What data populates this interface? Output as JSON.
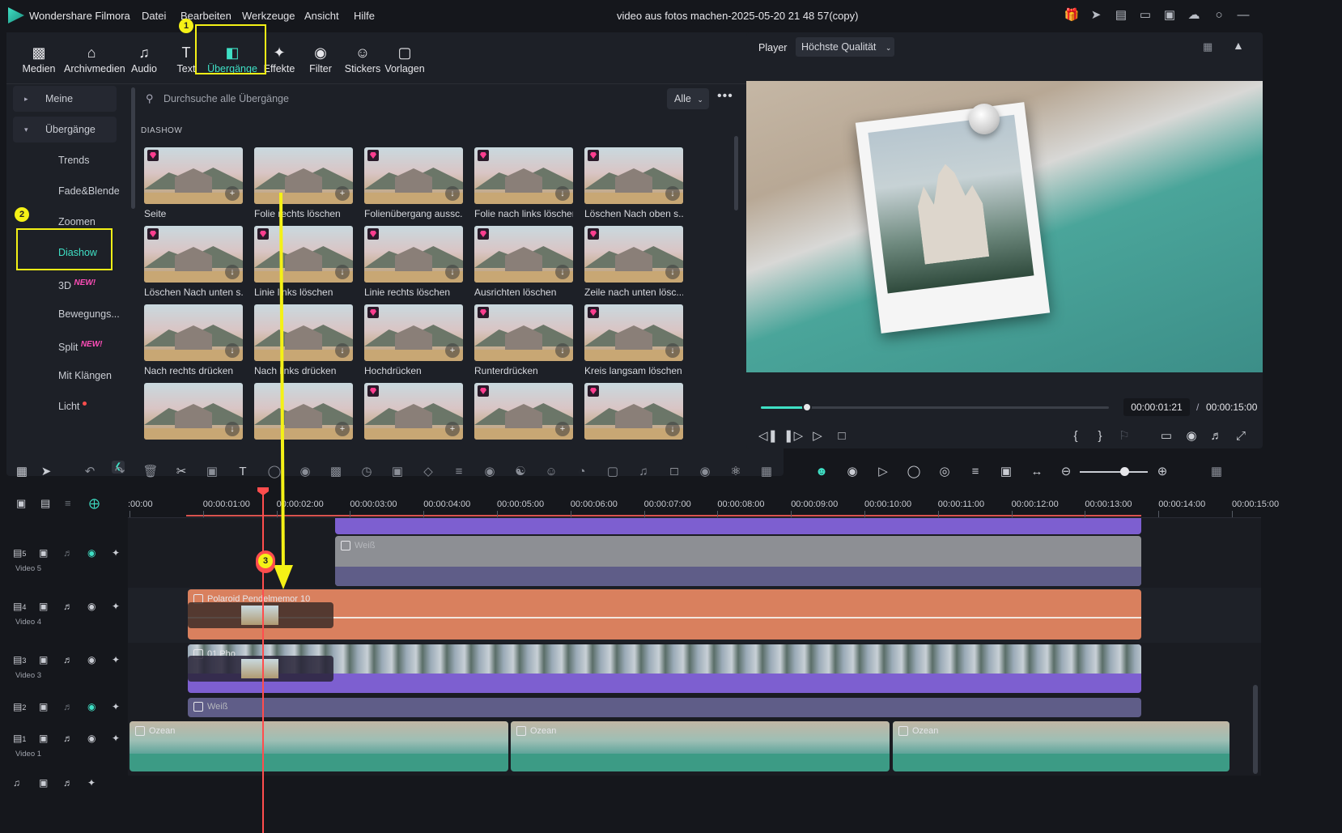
{
  "app": {
    "name": "Wondershare Filmora",
    "document_title": "video aus fotos machen-2025-05-20 21 48 57(copy)",
    "menu": [
      "Datei",
      "Bearbeiten",
      "Werkzeuge",
      "Ansicht",
      "Hilfe"
    ]
  },
  "colors": {
    "accent": "#3fe0c5",
    "highlight": "#f4f116",
    "playhead": "#ff4d4d",
    "clip_orange": "#d9805e",
    "clip_purple": "#7d5fd0",
    "clip_gray": "#8d8f94",
    "clip_teal": "#3c9b85"
  },
  "tabs": [
    {
      "label": "Medien",
      "icon": "media-icon"
    },
    {
      "label": "Archivmedien",
      "icon": "stock-media-icon"
    },
    {
      "label": "Audio",
      "icon": "music-note-icon"
    },
    {
      "label": "Text",
      "icon": "text-icon"
    },
    {
      "label": "Übergänge",
      "icon": "transition-icon",
      "active": true
    },
    {
      "label": "Effekte",
      "icon": "effects-icon"
    },
    {
      "label": "Filter",
      "icon": "filter-icon"
    },
    {
      "label": "Stickers",
      "icon": "sticker-icon"
    },
    {
      "label": "Vorlagen",
      "icon": "template-icon"
    }
  ],
  "sidebar": {
    "items": [
      {
        "label": "Meine",
        "type": "parent",
        "expanded": false
      },
      {
        "label": "Übergänge",
        "type": "parent",
        "expanded": true
      },
      {
        "label": "Trends",
        "type": "sub"
      },
      {
        "label": "Fade&Blende",
        "type": "sub"
      },
      {
        "label": "Zoomen",
        "type": "sub"
      },
      {
        "label": "Diashow",
        "type": "sub",
        "selected": true
      },
      {
        "label": "3D",
        "type": "sub",
        "tag": "NEW!"
      },
      {
        "label": "Bewegungs...",
        "type": "sub"
      },
      {
        "label": "Split",
        "type": "sub",
        "tag": "NEW!"
      },
      {
        "label": "Mit Klängen",
        "type": "sub"
      },
      {
        "label": "Licht",
        "type": "sub",
        "dot": true
      }
    ]
  },
  "search": {
    "placeholder": "Durchsuche alle Übergänge",
    "filter_value": "Alle"
  },
  "section_title": "DIASHOW",
  "transitions": [
    {
      "name": "Seite",
      "premium": true,
      "action": "add"
    },
    {
      "name": "Folie rechts löschen",
      "premium": false,
      "action": "add"
    },
    {
      "name": "Folienübergang aussc...",
      "premium": true,
      "action": "download"
    },
    {
      "name": "Folie nach links löschen",
      "premium": true,
      "action": "download"
    },
    {
      "name": "Löschen Nach oben s...",
      "premium": true,
      "action": "download"
    },
    {
      "name": "Löschen Nach unten s...",
      "premium": true,
      "action": "download"
    },
    {
      "name": "Linie links löschen",
      "premium": true,
      "action": "download"
    },
    {
      "name": "Linie rechts löschen",
      "premium": true,
      "action": "download"
    },
    {
      "name": "Ausrichten löschen",
      "premium": true,
      "action": "download"
    },
    {
      "name": "Zeile nach unten lösc...",
      "premium": true,
      "action": "download"
    },
    {
      "name": "Nach rechts drücken",
      "premium": false,
      "action": "download"
    },
    {
      "name": "Nach links drücken",
      "premium": false,
      "action": "download"
    },
    {
      "name": "Hochdrücken",
      "premium": true,
      "action": "add"
    },
    {
      "name": "Runterdrücken",
      "premium": true,
      "action": "download"
    },
    {
      "name": "Kreis langsam löschen",
      "premium": true,
      "action": "download"
    },
    {
      "name": "",
      "premium": false,
      "action": "download"
    },
    {
      "name": "",
      "premium": false,
      "action": "add"
    },
    {
      "name": "",
      "premium": true,
      "action": "add"
    },
    {
      "name": "",
      "premium": true,
      "action": "add"
    },
    {
      "name": "",
      "premium": true,
      "action": "download"
    }
  ],
  "player": {
    "label": "Player",
    "quality": "Höchste Qualität",
    "current_time": "00:00:01:21",
    "separator": "/",
    "duration": "00:00:15:00",
    "progress_fraction": 0.133
  },
  "timeline": {
    "ruler": [
      ":00:00",
      "00:00:01:00",
      "00:00:02:00",
      "00:00:03:00",
      "00:00:04:00",
      "00:00:05:00",
      "00:00:06:00",
      "00:00:07:00",
      "00:00:08:00",
      "00:00:09:00",
      "00:00:10:00",
      "00:00:11:00",
      "00:00:12:00",
      "00:00:13:00",
      "00:00:14:00",
      "00:00:15:00"
    ],
    "tracks": [
      {
        "number": "5",
        "label": "Video 5"
      },
      {
        "number": "4",
        "label": "Video 4"
      },
      {
        "number": "3",
        "label": "Video 3"
      },
      {
        "number": "2",
        "label": ""
      },
      {
        "number": "1",
        "label": "Video 1"
      }
    ],
    "clips": {
      "weiss_top": "Weiß",
      "polaroid": "Polaroid Pendelmemor 10",
      "photo": "01 Pho",
      "weiss_bottom": "Weiß",
      "ozean": "Ozean"
    }
  },
  "annotations": [
    "1",
    "2",
    "3"
  ]
}
